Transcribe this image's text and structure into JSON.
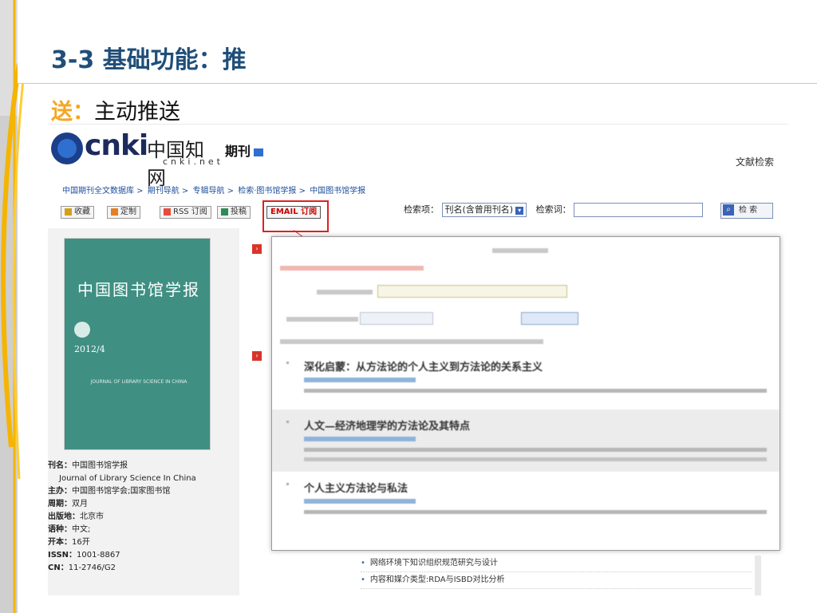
{
  "slide": {
    "title": "3-3 基础功能：推",
    "subtitle_accent": "送：",
    "subtitle_rest": "主动推送"
  },
  "site": {
    "logo_text": "cnki",
    "logo_cn": "中国知网",
    "logo_sub": "cnki.net",
    "section_title": "期刊",
    "right_link": "文献检索"
  },
  "breadcrumb": [
    "中国期刊全文数据库 >",
    "期刊导航 >",
    "专辑导航 >",
    "检索·图书馆学报 >",
    "中国图书馆学报"
  ],
  "toolbar": {
    "buttons": [
      {
        "label": "收藏",
        "icon": "bookmark-icon",
        "color": "#d4a017"
      },
      {
        "label": "定制",
        "icon": "customize-icon",
        "color": "#e67e22"
      },
      {
        "label": "RSS 订阅",
        "icon": "rss-icon",
        "color": "#e74c3c"
      },
      {
        "label": "投稿",
        "icon": "submit-icon",
        "color": "#2e8b57"
      },
      {
        "label": "EMAIL 订阅",
        "icon": "email-icon",
        "color": "#c00000"
      }
    ]
  },
  "search": {
    "field_label": "检索项：",
    "field_value": "刊名(含曾用刊名)",
    "keyword_label": "检索词：",
    "keyword_value": "",
    "button_label": "检 索"
  },
  "journal": {
    "cover_title": "中国图书馆学报",
    "cover_issue": "2012/4",
    "cover_en": "JOURNAL OF LIBRARY SCIENCE IN CHINA",
    "info": [
      {
        "key": "刊名：",
        "value": "中国图书馆学报"
      },
      {
        "key": "",
        "value": "Journal of Library Science In China"
      },
      {
        "key": "主办：",
        "value": "中国图书馆学会;国家图书馆"
      },
      {
        "key": "周期：",
        "value": "双月"
      },
      {
        "key": "出版地：",
        "value": "北京市"
      },
      {
        "key": "语种：",
        "value": "中文;"
      },
      {
        "key": "开本：",
        "value": "16开"
      },
      {
        "key": "ISSN：",
        "value": "1001-8867"
      },
      {
        "key": "CN：",
        "value": "11-2746/G2"
      }
    ]
  },
  "popup": {
    "articles": [
      {
        "title": "深化启蒙：从方法论的个人主义到方法论的关系主义"
      },
      {
        "title": "人文—经济地理学的方法论及其特点"
      },
      {
        "title": "个人主义方法论与私法"
      }
    ]
  },
  "below_list": [
    "网络环境下知识组织规范研究与设计",
    "内容和媒介类型:RDA与ISBD对比分析"
  ]
}
